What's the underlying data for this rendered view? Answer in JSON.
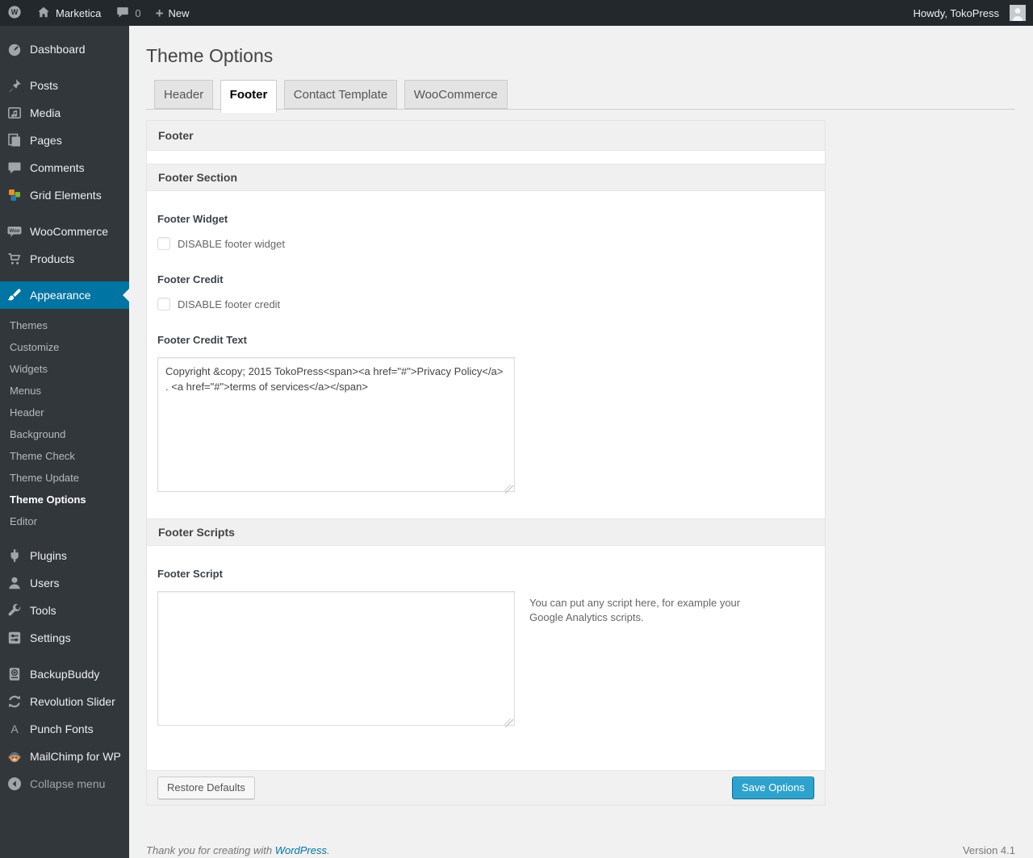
{
  "admin_bar": {
    "site_name": "Marketica",
    "comments_count": "0",
    "new_label": "New",
    "howdy": "Howdy, TokoPress"
  },
  "sidebar": {
    "items": [
      {
        "icon": "dashboard-icon",
        "label": "Dashboard"
      },
      {
        "icon": "pin-icon",
        "label": "Posts"
      },
      {
        "icon": "media-icon",
        "label": "Media"
      },
      {
        "icon": "pages-icon",
        "label": "Pages"
      },
      {
        "icon": "comments-icon",
        "label": "Comments"
      },
      {
        "icon": "grid-elements-icon",
        "label": "Grid Elements"
      },
      {
        "icon": "woocommerce-icon",
        "label": "WooCommerce"
      },
      {
        "icon": "cart-icon",
        "label": "Products"
      },
      {
        "icon": "brush-icon",
        "label": "Appearance"
      },
      {
        "icon": "plugin-icon",
        "label": "Plugins"
      },
      {
        "icon": "users-icon",
        "label": "Users"
      },
      {
        "icon": "tools-icon",
        "label": "Tools"
      },
      {
        "icon": "settings-icon",
        "label": "Settings"
      },
      {
        "icon": "backupbuddy-icon",
        "label": "BackupBuddy"
      },
      {
        "icon": "revolution-slider-icon",
        "label": "Revolution Slider"
      },
      {
        "icon": "punch-fonts-icon",
        "label": "Punch Fonts"
      },
      {
        "icon": "mailchimp-icon",
        "label": "MailChimp for WP"
      },
      {
        "icon": "collapse-icon",
        "label": "Collapse menu"
      }
    ],
    "appearance_submenu": [
      {
        "label": "Themes"
      },
      {
        "label": "Customize"
      },
      {
        "label": "Widgets"
      },
      {
        "label": "Menus"
      },
      {
        "label": "Header"
      },
      {
        "label": "Background"
      },
      {
        "label": "Theme Check"
      },
      {
        "label": "Theme Update"
      },
      {
        "label": "Theme Options"
      },
      {
        "label": "Editor"
      }
    ]
  },
  "page": {
    "title": "Theme Options",
    "tabs": [
      {
        "label": "Header"
      },
      {
        "label": "Footer"
      },
      {
        "label": "Contact Template"
      },
      {
        "label": "WooCommerce"
      }
    ]
  },
  "panel": {
    "box_title": "Footer",
    "section_footer_title": "Footer Section",
    "footer_widget_label": "Footer Widget",
    "footer_widget_checkbox": "DISABLE footer widget",
    "footer_credit_label": "Footer Credit",
    "footer_credit_checkbox": "DISABLE footer credit",
    "footer_credit_text_label": "Footer Credit Text",
    "footer_credit_text_value": "Copyright &copy; 2015 TokoPress<span><a href=\"#\">Privacy Policy</a> . <a href=\"#\">terms of services</a></span>",
    "section_scripts_title": "Footer Scripts",
    "footer_script_label": "Footer Script",
    "footer_script_value": "",
    "footer_script_help": "You can put any script here, for example your Google Analytics scripts.",
    "restore_button": "Restore Defaults",
    "save_button": "Save Options"
  },
  "page_footer": {
    "thanks_prefix": "Thank you for creating with ",
    "wordpress_link": "WordPress",
    "thanks_suffix": ".",
    "version": "Version 4.1"
  },
  "colors": {
    "admin_bar_bg": "#23282d",
    "sidebar_bg": "#32373c",
    "accent_blue": "#0074a2",
    "primary_button": "#2ea2cc",
    "page_bg": "#f1f1f1"
  }
}
